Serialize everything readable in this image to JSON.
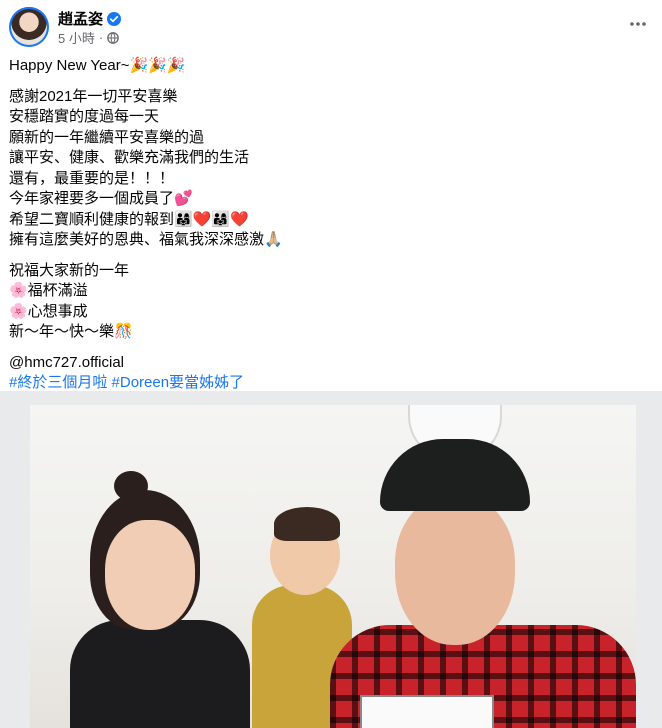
{
  "post": {
    "author": "趙孟姿",
    "timestamp": "5 小時",
    "separator": "·",
    "icons": {
      "verified": "verified-badge-icon",
      "audience": "globe-icon",
      "more": "more-horizontal-icon"
    },
    "colors": {
      "link": "#1877f2",
      "meta": "#65676b",
      "verified": "#1877f2"
    }
  },
  "content": {
    "lines": [
      "Happy New Year~🎉🎉🎉",
      "感謝2021年一切平安喜樂",
      "安穩踏實的度過每一天",
      "願新的一年繼續平安喜樂的過",
      "讓平安、健康、歡樂充滿我們的生活",
      "還有，最重要的是！！！",
      "今年家裡要多一個成員了💕",
      "希望二寶順利健康的報到👨‍👩‍👧❤️👨‍👩‍👧❤️",
      "擁有這麼美好的恩典、福氣我深深感激🙏🏼",
      "祝福大家新的一年",
      "🌸福杯滿溢",
      "🌸心想事成",
      "新～年～快～樂🎊",
      "@hmc727.official"
    ],
    "hashtags": [
      "#終於三個月啦",
      "#Doreen要當姊姊了"
    ]
  }
}
